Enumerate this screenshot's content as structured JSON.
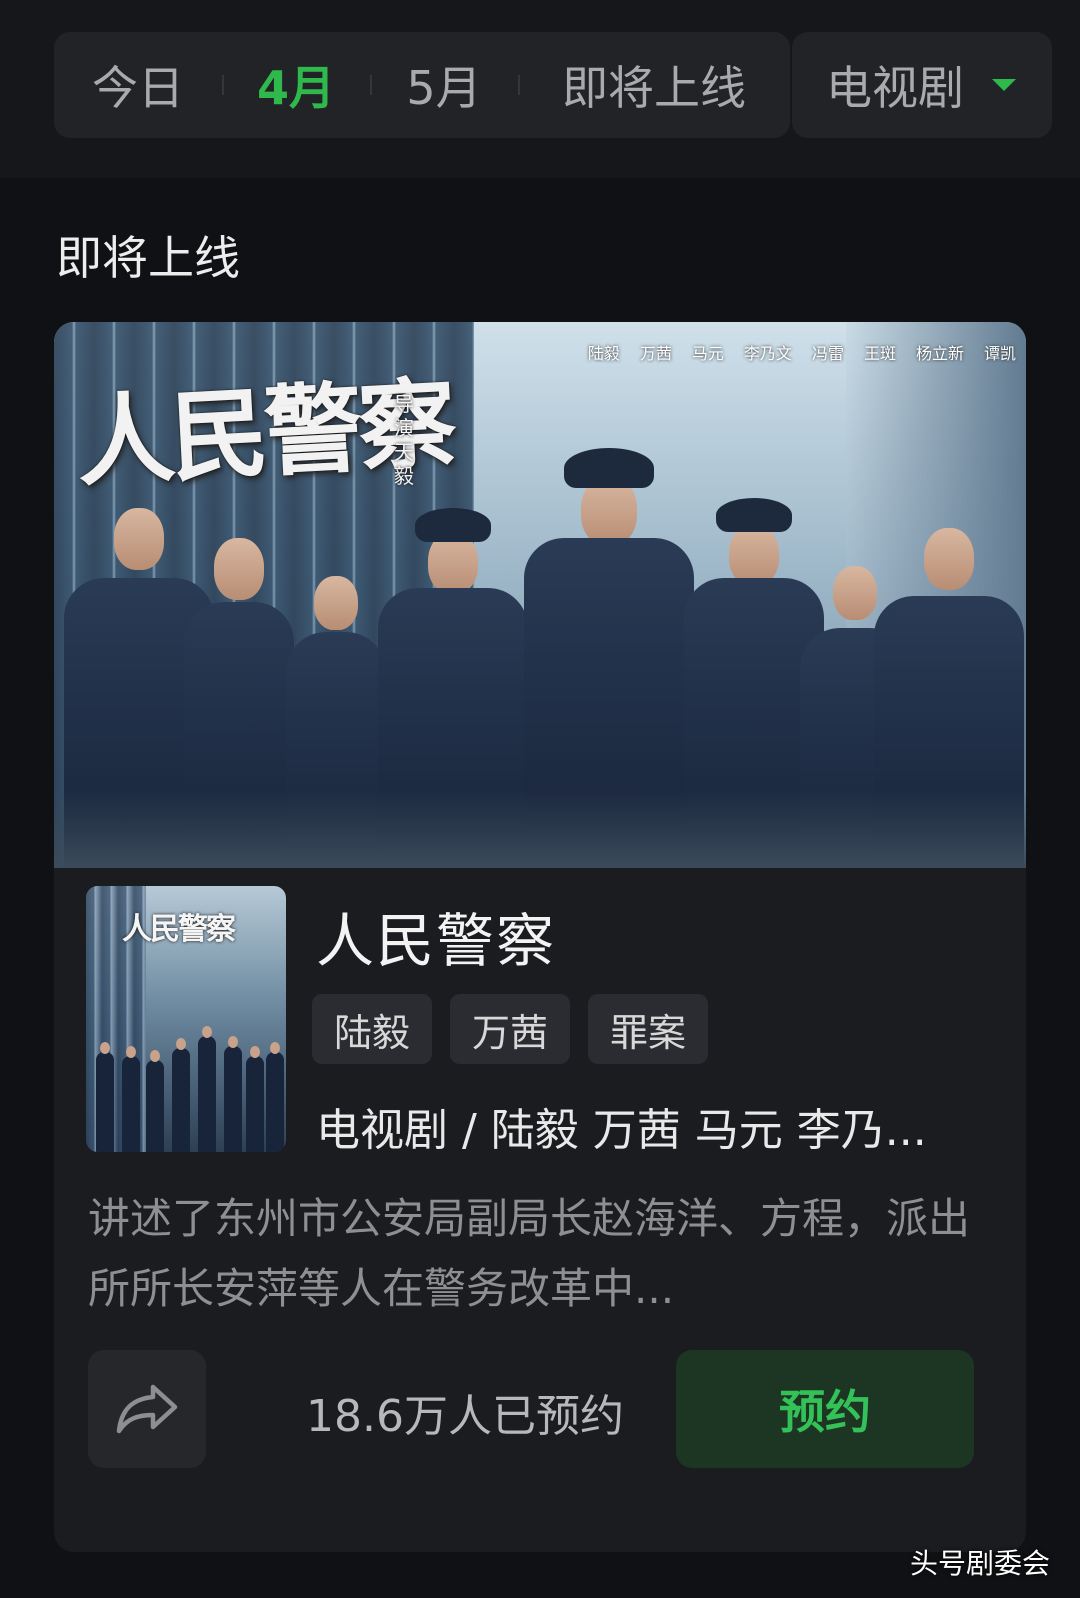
{
  "filter_tabs": [
    {
      "label": "今日",
      "active": false
    },
    {
      "label": "4月",
      "active": true
    },
    {
      "label": "5月",
      "active": false
    },
    {
      "label": "即将上线",
      "active": false
    }
  ],
  "type_filter": {
    "selected": "电视剧",
    "icon": "caret-down-icon"
  },
  "section": {
    "title": "即将上线"
  },
  "show": {
    "poster": {
      "title_art": "人民警察",
      "director_credit": "导演 天毅",
      "cast_credits": [
        "陆毅",
        "万茜",
        "马元",
        "李乃文",
        "冯雷",
        "王斑",
        "杨立新",
        "谭凯"
      ]
    },
    "thumbnail_title_art": "人民警察",
    "title": "人民警察",
    "tags": [
      "陆毅",
      "万茜",
      "罪案"
    ],
    "meta": "电视剧 / 陆毅 万茜 马元 李乃...",
    "description": "讲述了东州市公安局副局长赵海洋、方程，派出所所长安萍等人在警务改革中...",
    "reserved_count": "18.6万人已预约",
    "reserve_label": "预约",
    "share_icon": "share-icon"
  },
  "watermark": "头号剧委会",
  "colors": {
    "accent_green": "#2fb94d",
    "background": "#101114",
    "card": "#1b1c20"
  }
}
